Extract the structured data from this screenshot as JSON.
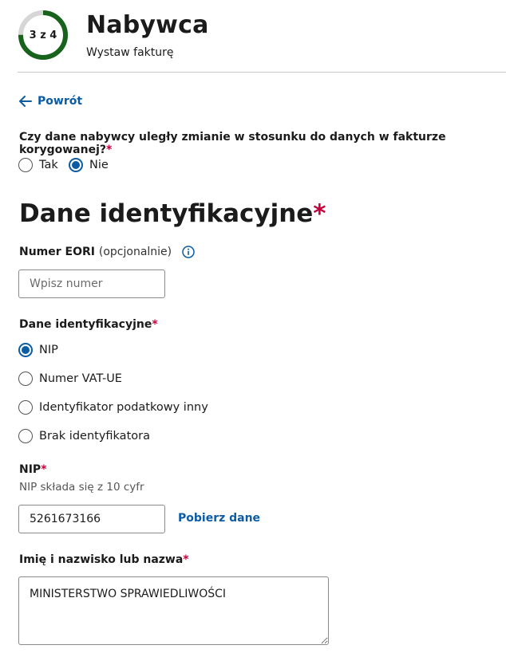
{
  "header": {
    "step_label": "3 z 4",
    "step_progress": 0.75,
    "title": "Nabywca",
    "subtitle": "Wystaw fakturę"
  },
  "nav": {
    "back_label": "Powrót"
  },
  "question": {
    "label": "Czy dane nabywcy uległy zmianie w stosunku do danych w fakturze korygowanej?",
    "required_mark": "*",
    "options": [
      {
        "label": "Tak",
        "checked": false
      },
      {
        "label": "Nie",
        "checked": true
      }
    ]
  },
  "section": {
    "title": "Dane identyfikacyjne",
    "required_mark": "*"
  },
  "eori": {
    "label": "Numer EORI",
    "optional_text": "(opcjonalnie)",
    "placeholder": "Wpisz numer",
    "value": ""
  },
  "identification": {
    "label": "Dane identyfikacyjne",
    "required_mark": "*",
    "options": [
      {
        "label": "NIP",
        "checked": true
      },
      {
        "label": "Numer VAT-UE",
        "checked": false
      },
      {
        "label": "Identyfikator podatkowy inny",
        "checked": false
      },
      {
        "label": "Brak identyfikatora",
        "checked": false
      }
    ]
  },
  "nip": {
    "label": "NIP",
    "required_mark": "*",
    "hint": "NIP składa się z 10 cyfr",
    "value": "5261673166",
    "fetch_label": "Pobierz dane"
  },
  "name_field": {
    "label": "Imię i nazwisko lub nazwa",
    "required_mark": "*",
    "value": "MINISTERSTWO SPRAWIEDLIWOŚCI"
  },
  "colors": {
    "primary": "#0b5ca5",
    "required": "#c4003b",
    "progress": "#17631c",
    "progress_track": "#d6d6d6"
  }
}
